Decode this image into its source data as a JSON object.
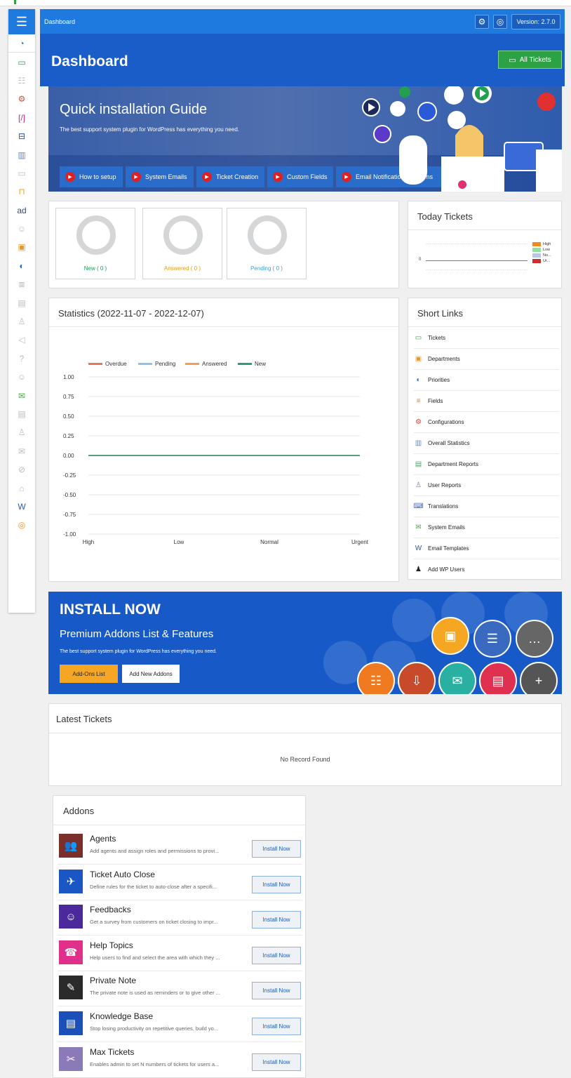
{
  "topbar": {
    "breadcrumb": "Dashboard",
    "version": "Version: 2.7.0"
  },
  "header": {
    "title": "Dashboard",
    "all_tickets": "All Tickets"
  },
  "guide": {
    "title": "Quick installation Guide",
    "subtitle": "The best support system plugin for WordPress has everything you need.",
    "buttons": [
      "How to setup",
      "System Emails",
      "Ticket Creation",
      "Custom Fields",
      "Email Notification Problems"
    ]
  },
  "stats": [
    {
      "label": "New ( 0 )",
      "color": "#1a9a5a"
    },
    {
      "label": "Answered ( 0 )",
      "color": "#e69a10"
    },
    {
      "label": "Pending ( 0 )",
      "color": "#3aa0d8"
    }
  ],
  "today": {
    "title": "Today Tickets",
    "axis_zero": "0",
    "legend": [
      {
        "name": "High",
        "color": "#f0891f"
      },
      {
        "name": "Low",
        "color": "#8fe39a"
      },
      {
        "name": "No...",
        "color": "#b8c7e8"
      },
      {
        "name": "Ur...",
        "color": "#c9302c"
      }
    ]
  },
  "statistics": {
    "title": "Statistics (2022-11-07 - 2022-12-07)"
  },
  "chart_data": {
    "type": "line",
    "categories": [
      "High",
      "Low",
      "Normal",
      "Urgent"
    ],
    "series": [
      {
        "name": "Overdue",
        "color": "#e8735a",
        "values": [
          0,
          0,
          0,
          0
        ]
      },
      {
        "name": "Pending",
        "color": "#89c4ea",
        "values": [
          0,
          0,
          0,
          0
        ]
      },
      {
        "name": "Answered",
        "color": "#f0a050",
        "values": [
          0,
          0,
          0,
          0
        ]
      },
      {
        "name": "New",
        "color": "#2f9a74",
        "values": [
          0,
          0,
          0,
          0
        ]
      }
    ],
    "yticks": [
      "1.00",
      "0.75",
      "0.50",
      "0.25",
      "0.00",
      "-0.25",
      "-0.50",
      "-0.75",
      "-1.00"
    ],
    "ylim": [
      -1,
      1
    ],
    "legend": "top",
    "grid": true
  },
  "short_links": {
    "title": "Short Links",
    "items": [
      {
        "label": "Tickets",
        "icon": "ticket-icon",
        "glyph": "▭",
        "color": "#2e9d4a"
      },
      {
        "label": "Departments",
        "icon": "department-icon",
        "glyph": "▣",
        "color": "#e69a2e"
      },
      {
        "label": "Priorities",
        "icon": "priority-icon",
        "glyph": "◐",
        "color": "#1f6fd6"
      },
      {
        "label": "Fields",
        "icon": "fields-icon",
        "glyph": "≡",
        "color": "#b08a6a"
      },
      {
        "label": "Configurations",
        "icon": "gear-icon",
        "glyph": "⚙",
        "color": "#e04a3a"
      },
      {
        "label": "Overall Statistics",
        "icon": "chart-icon",
        "glyph": "▥",
        "color": "#6a8ab5"
      },
      {
        "label": "Department Reports",
        "icon": "report-icon",
        "glyph": "▤",
        "color": "#4aa868"
      },
      {
        "label": "User Reports",
        "icon": "user-icon",
        "glyph": "♙",
        "color": "#9a6ad6"
      },
      {
        "label": "Translations",
        "icon": "translation-icon",
        "glyph": "⌨",
        "color": "#4a6ab8"
      },
      {
        "label": "System Emails",
        "icon": "email-icon",
        "glyph": "✉",
        "color": "#48a848"
      },
      {
        "label": "Email Templates",
        "icon": "template-icon",
        "glyph": "W",
        "color": "#2a5ab8"
      },
      {
        "label": "Add WP Users",
        "icon": "add-user-icon",
        "glyph": "♟",
        "color": "#222222"
      }
    ]
  },
  "install": {
    "title": "INSTALL NOW",
    "subtitle": "Premium Addons List & Features",
    "desc": "The best support system plugin for WordPress has everything you need.",
    "btn_addons": "Add-Ons List",
    "btn_new": "Add New Addons"
  },
  "latest": {
    "title": "Latest Tickets",
    "empty": "No Record Found"
  },
  "addons": {
    "title": "Addons",
    "install_label": "Install Now",
    "items": [
      {
        "title": "Agents",
        "desc": "Add agents and assign roles and permissions to provi...",
        "icon": "agents-icon",
        "glyph": "👥",
        "color": "#7a2f2a"
      },
      {
        "title": "Ticket Auto Close",
        "desc": "Define rules for the ticket to auto-close after a specifi...",
        "icon": "auto-close-icon",
        "glyph": "✈",
        "color": "#1a56c4"
      },
      {
        "title": "Feedbacks",
        "desc": "Get a survey from customers on ticket closing to impr...",
        "icon": "feedback-icon",
        "glyph": "☺",
        "color": "#4a2a9a"
      },
      {
        "title": "Help Topics",
        "desc": "Help users to find and select the area with which they ...",
        "icon": "help-topics-icon",
        "glyph": "☎",
        "color": "#e0308a"
      },
      {
        "title": "Private Note",
        "desc": "The private note is used as reminders or to give other ...",
        "icon": "note-icon",
        "glyph": "✎",
        "color": "#2a2a2a"
      },
      {
        "title": "Knowledge Base",
        "desc": "Stop losing productivity on repetitive queries, build yo...",
        "icon": "knowledge-base-icon",
        "glyph": "▤",
        "color": "#1a50b8"
      },
      {
        "title": "Max Tickets",
        "desc": "Enables admin to set N numbers of tickets for users a...",
        "icon": "max-tickets-icon",
        "glyph": "✂",
        "color": "#8a7ab8"
      }
    ]
  },
  "sidebar_icons": [
    {
      "name": "dashboard-icon",
      "glyph": "◔",
      "color": "#1f6fd6"
    },
    {
      "name": "ticket-icon",
      "glyph": "▭",
      "color": "#2e9d4a"
    },
    {
      "name": "agents-icon",
      "glyph": "☷",
      "color": "#bbbbbb"
    },
    {
      "name": "gear-icon",
      "glyph": "⚙",
      "color": "#e04a3a"
    },
    {
      "name": "code-icon",
      "glyph": "[/]",
      "color": "#c02a8a"
    },
    {
      "name": "form-icon",
      "glyph": "⊟",
      "color": "#2a4a8a"
    },
    {
      "name": "chart-icon",
      "glyph": "▥",
      "color": "#6a8ab5"
    },
    {
      "name": "ticket-list-icon",
      "glyph": "▭",
      "color": "#bbbbbb"
    },
    {
      "name": "lock-icon",
      "glyph": "⊓",
      "color": "#f0a020"
    },
    {
      "name": "ad-icon",
      "glyph": "ad",
      "color": "#3a4a6a"
    },
    {
      "name": "smile-icon",
      "glyph": "☺",
      "color": "#bbbbbb"
    },
    {
      "name": "department-icon",
      "glyph": "▣",
      "color": "#e69a2e"
    },
    {
      "name": "priority-icon",
      "glyph": "◐",
      "color": "#1f6fd6"
    },
    {
      "name": "fields-icon",
      "glyph": "≣",
      "color": "#bbbbbb"
    },
    {
      "name": "note-icon",
      "glyph": "▤",
      "color": "#bbbbbb"
    },
    {
      "name": "user-icon",
      "glyph": "♙",
      "color": "#bbbbbb"
    },
    {
      "name": "sound-icon",
      "glyph": "◁",
      "color": "#bbbbbb"
    },
    {
      "name": "help-icon",
      "glyph": "?",
      "color": "#bbbbbb"
    },
    {
      "name": "support-icon",
      "glyph": "☺",
      "color": "#bbbbbb"
    },
    {
      "name": "email-icon",
      "glyph": "✉",
      "color": "#48a848"
    },
    {
      "name": "document-icon",
      "glyph": "▤",
      "color": "#bbbbbb"
    },
    {
      "name": "add-user-icon",
      "glyph": "♙",
      "color": "#bbbbbb"
    },
    {
      "name": "mail-icon",
      "glyph": "✉",
      "color": "#bbbbbb"
    },
    {
      "name": "ban-icon",
      "glyph": "⊘",
      "color": "#bbbbbb"
    },
    {
      "name": "inbox-icon",
      "glyph": "⌂",
      "color": "#bbbbbb"
    },
    {
      "name": "template-icon",
      "glyph": "W",
      "color": "#2a5ab8"
    },
    {
      "name": "lifebuoy-icon",
      "glyph": "◎",
      "color": "#f08a20"
    }
  ]
}
